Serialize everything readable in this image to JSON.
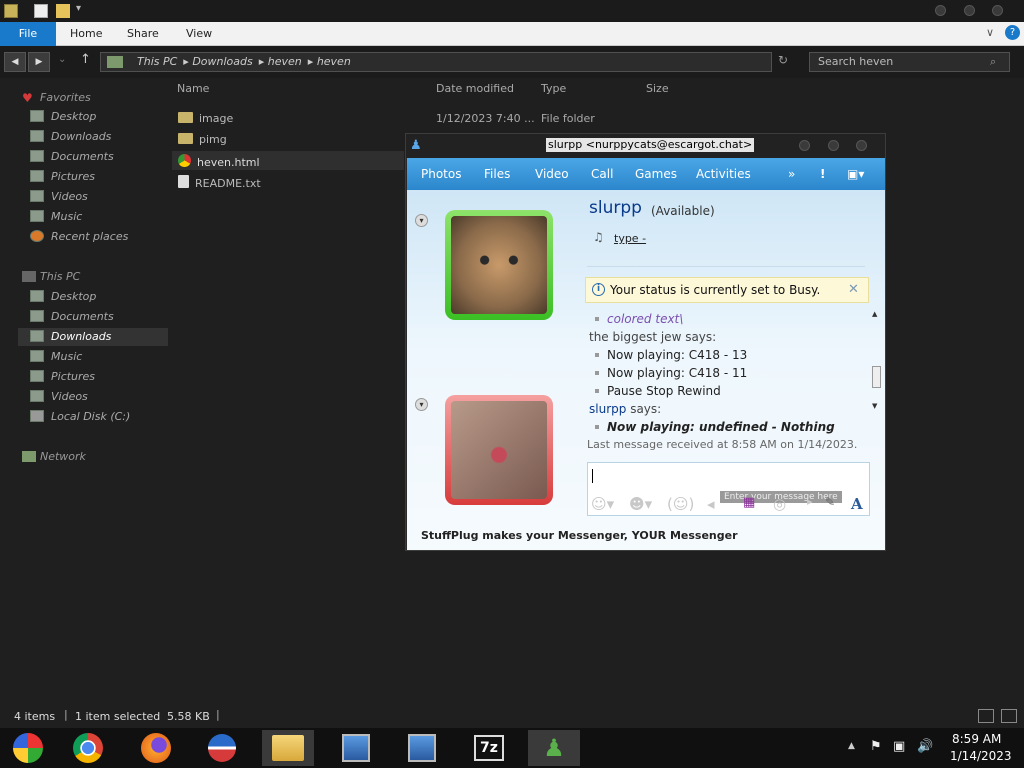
{
  "ribbon": {
    "file": "File",
    "tabs": [
      "Home",
      "Share",
      "View"
    ]
  },
  "address": {
    "crumbs": [
      "This PC",
      "Downloads",
      "heven",
      "heven"
    ],
    "search_placeholder": "Search heven"
  },
  "sidebar": {
    "favorites": "Favorites",
    "fav_items": [
      "Desktop",
      "Downloads",
      "Documents",
      "Pictures",
      "Videos",
      "Music",
      "Recent places"
    ],
    "thispc": "This PC",
    "pc_items": [
      "Desktop",
      "Documents",
      "Downloads",
      "Music",
      "Pictures",
      "Videos",
      "Local Disk (C:)"
    ],
    "network": "Network"
  },
  "columns": {
    "name": "Name",
    "date": "Date modified",
    "type": "Type",
    "size": "Size"
  },
  "files": [
    {
      "name": "image",
      "date": "1/12/2023 7:40 ...",
      "type": "File folder"
    },
    {
      "name": "pimg",
      "date": "",
      "type": ""
    },
    {
      "name": "heven.html",
      "date": "",
      "type": ""
    },
    {
      "name": "README.txt",
      "date": "",
      "type": ""
    }
  ],
  "statusbar": {
    "items": "4 items",
    "selected": "1 item selected",
    "size": "5.58 KB"
  },
  "clock": {
    "time": "8:59 AM",
    "date": "1/14/2023"
  },
  "messenger": {
    "title": "slurpp <nurppycats@escargot.chat>",
    "toolbar": [
      "Photos",
      "Files",
      "Video",
      "Call",
      "Games",
      "Activities"
    ],
    "contact_name": "slurpp",
    "contact_status": "(Available)",
    "psm": "type -",
    "status_notice": "Your status is currently set to Busy.",
    "messages": {
      "colored": "colored text\\",
      "sender1": "the biggest jew says:",
      "lines1": [
        "Now playing: C418 - 13",
        "Now playing: C418 - 11",
        "Pause Stop Rewind"
      ],
      "sender2": "slurpp",
      "says": "says:",
      "line2": "Now playing: undefined - Nothing",
      "last": "Last message received at 8:58 AM on 1/14/2023."
    },
    "input_placeholder": "Enter your message here",
    "footer": "StuffPlug makes your Messenger, YOUR Messenger"
  },
  "colors": {
    "accent": "#1979ca",
    "msn_blue": "#2f93d8",
    "link_purple": "#7a4fb0"
  }
}
